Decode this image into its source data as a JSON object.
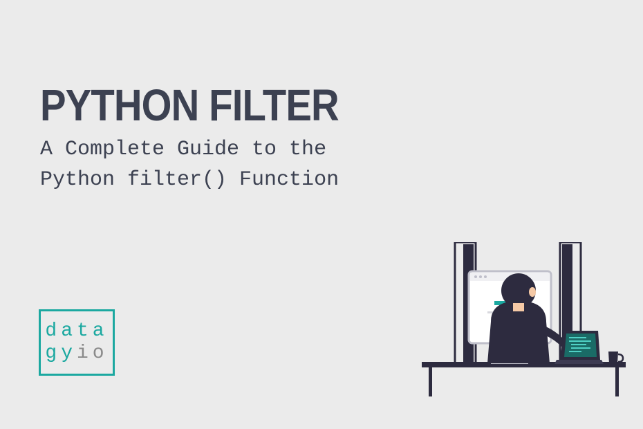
{
  "header": {
    "title": "PYTHON FILTER",
    "subtitle_line1": "A Complete Guide to the",
    "subtitle_line2": "Python filter() Function"
  },
  "logo": {
    "line1_part1": "data",
    "line2_part1": "gy",
    "line2_part2": "io"
  },
  "colors": {
    "background": "#ebebeb",
    "text_primary": "#3c4151",
    "accent_teal": "#1ba8a0",
    "logo_gray": "#8a8a8a",
    "illustration_dark": "#2d2b3f",
    "illustration_skin": "#f5c9a6"
  },
  "illustration": {
    "description": "Person sitting at desk viewed from behind working on computer monitor with laptop to the side"
  }
}
